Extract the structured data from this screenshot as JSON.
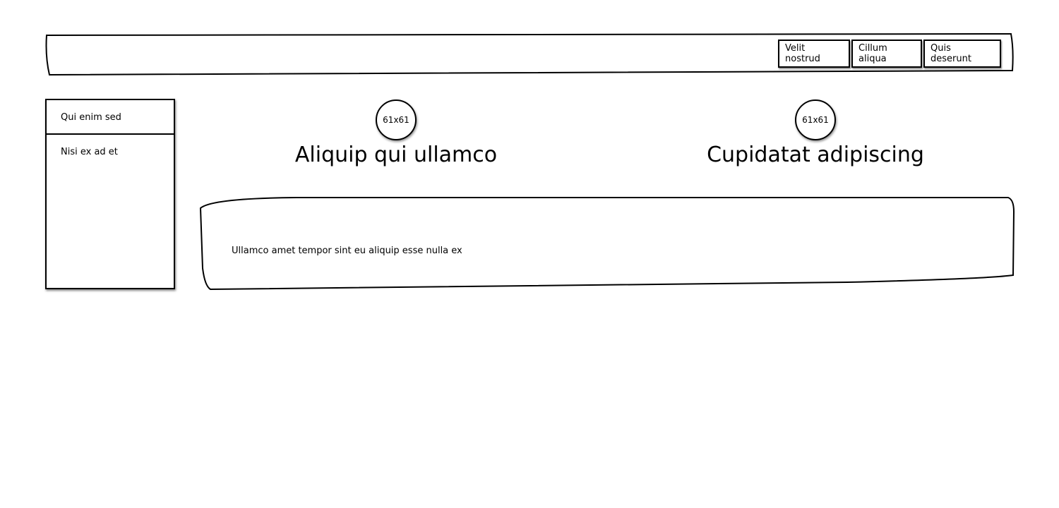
{
  "header": {
    "nav": [
      {
        "label": "Velit nostrud"
      },
      {
        "label": "Cillum aliqua"
      },
      {
        "label": "Quis deserunt"
      }
    ]
  },
  "sidebar": {
    "items": [
      {
        "label": "Qui enim sed"
      },
      {
        "label": "Nisi ex ad et"
      }
    ]
  },
  "features": [
    {
      "avatar_text": "61x61",
      "title": "Aliquip qui ullamco"
    },
    {
      "avatar_text": "61x61",
      "title": "Cupidatat adipiscing"
    }
  ],
  "content": {
    "text": "Ullamco amet tempor sint eu aliquip esse nulla ex"
  }
}
